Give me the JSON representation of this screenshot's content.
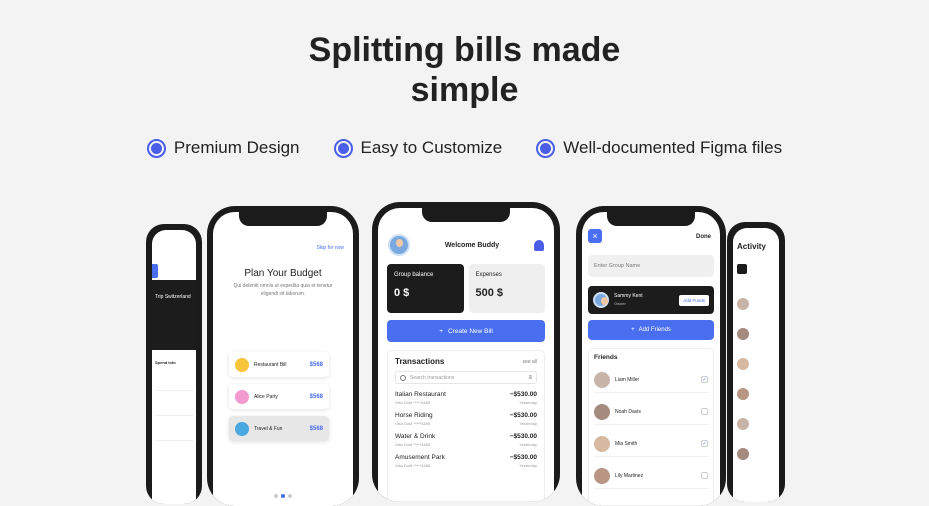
{
  "headline": {
    "line1": "Splitting bills made",
    "line2": "simple"
  },
  "features": [
    {
      "label": "Premium Design"
    },
    {
      "label": "Easy to Customize"
    },
    {
      "label": "Well-documented Figma files"
    }
  ],
  "onboarding": {
    "skip": "Skip for now",
    "title": "Plan Your Budget",
    "description": "Qui deleniti omnis ut expedita quia et tenetur eligendi sit laborum.",
    "bills": [
      {
        "name": "Restaurant Bill",
        "amount": "$568",
        "icon_color": "#f7c53a"
      },
      {
        "name": "Alice Party",
        "amount": "$568",
        "icon_color": "#f39ad0"
      },
      {
        "name": "Travel & Fun",
        "amount": "$568",
        "icon_color": "#4aa7e0"
      }
    ]
  },
  "dashboard": {
    "welcome": "Welcome Buddy",
    "group_balance_label": "Group balance",
    "group_balance": "0 $",
    "expenses_label": "Expenses",
    "expenses": "500 $",
    "create_bill": "Create New Bill",
    "transactions_title": "Transactions",
    "see_all": "see all",
    "search_placeholder": "Search transactions",
    "transactions": [
      {
        "name": "Italian Restaurant",
        "card": "Visa Gold *****4485",
        "amount": "−$530.00",
        "date": "Yesterday"
      },
      {
        "name": "Horse Riding",
        "card": "Visa Gold *****4485",
        "amount": "−$530.00",
        "date": "Yesterday"
      },
      {
        "name": "Water & Drink",
        "card": "Visa Gold *****4485",
        "amount": "−$530.00",
        "date": "Yesterday"
      },
      {
        "name": "Amusement Park",
        "card": "Visa Gold *****4485",
        "amount": "−$530.00",
        "date": "Yesterday"
      }
    ]
  },
  "group": {
    "close": "×",
    "done": "Done",
    "name_placeholder": "Enter Group Name",
    "creator_name": "Sammy Kent",
    "creator_role": "Owner",
    "add_funds": "Add Funds",
    "add_friends": "Add Friends",
    "friends_title": "Friends",
    "friends": [
      {
        "name": "Liam Miller",
        "checked": "✓"
      },
      {
        "name": "Noah Davis",
        "checked": ""
      },
      {
        "name": "Mia Smith",
        "checked": "✓"
      },
      {
        "name": "Lily Martinez",
        "checked": ""
      }
    ]
  },
  "side_left": {
    "title": "Trip Switzerland",
    "section": "Spend Info"
  },
  "side_right": {
    "title": "Activity"
  },
  "colors": {
    "accent": "#4a6ef0",
    "dark": "#1c1c1c"
  }
}
